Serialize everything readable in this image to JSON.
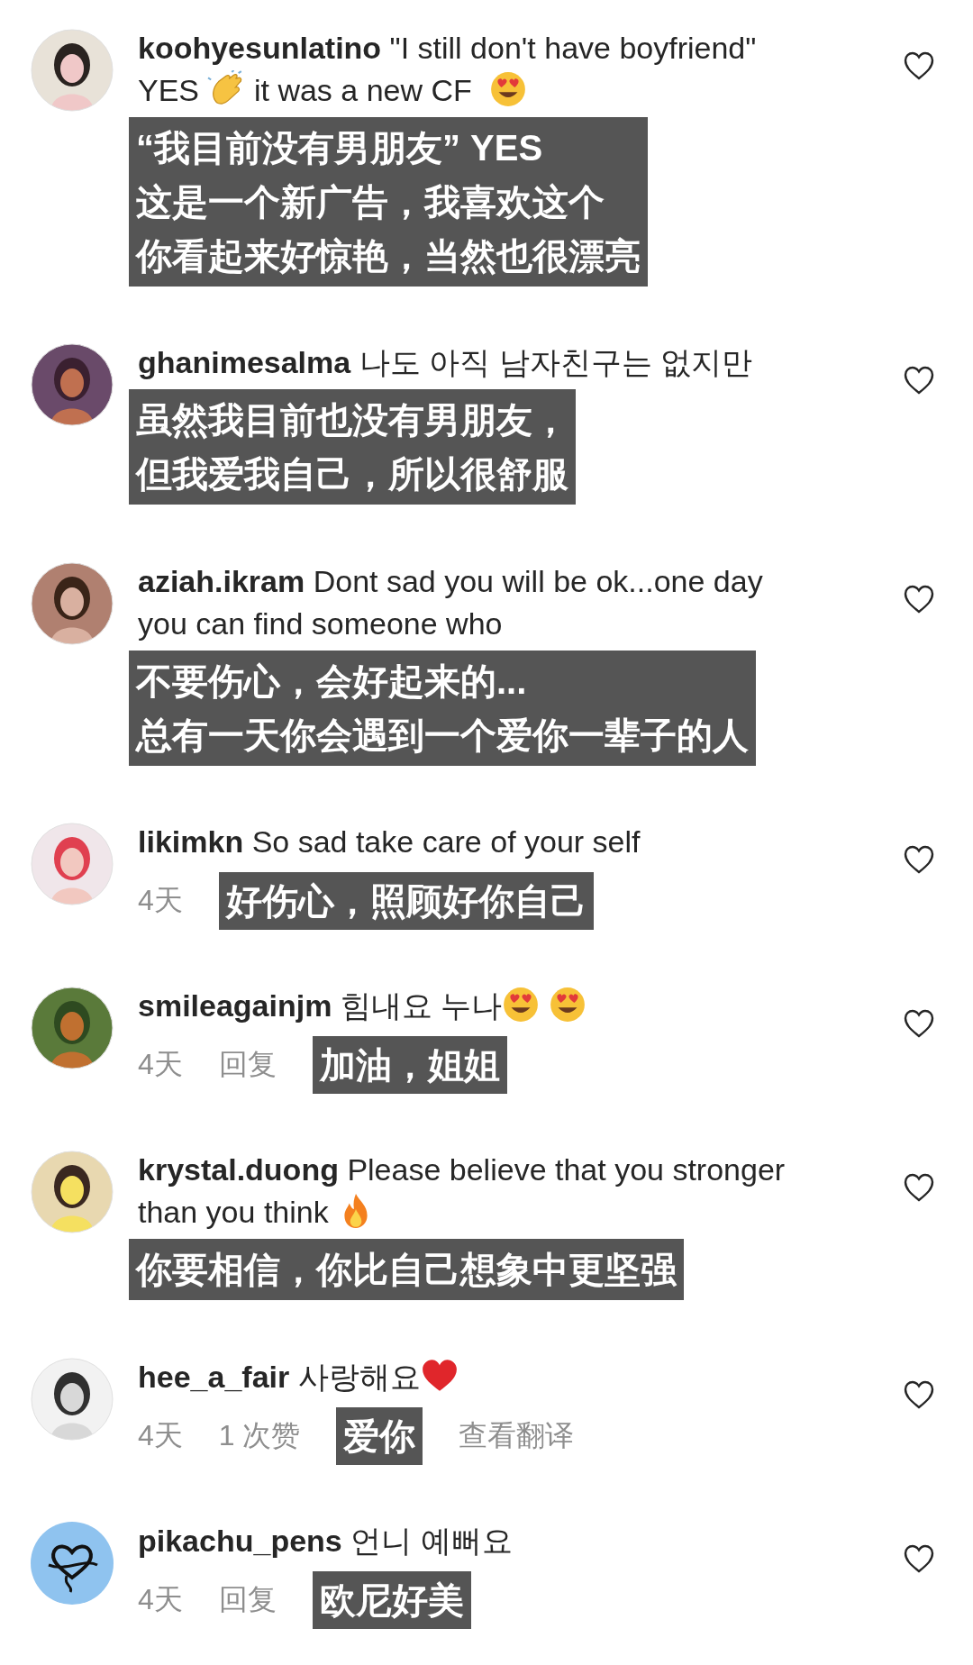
{
  "comments": [
    {
      "avatar": {
        "kind": "picture"
      },
      "username": "koohyesunlatino",
      "parts": [
        {
          "kind": "text",
          "text": "\"I still don't have boyfriend\"  YES "
        },
        {
          "kind": "clap"
        },
        {
          "kind": "text",
          "text": " it was a new CF "
        },
        {
          "kind": "heart-eyes"
        }
      ],
      "caption": [
        "“我目前没有男朋友” YES",
        "这是一个新广告，我喜欢这个",
        "你看起来好惊艳，当然也很漂亮"
      ],
      "liked": false
    },
    {
      "avatar": {
        "kind": "picture"
      },
      "username": "ghanimesalma",
      "parts": [
        {
          "kind": "text",
          "text": "나도 아직 남자친구는 없지만"
        }
      ],
      "caption": [
        "虽然我目前也没有男朋友，",
        "但我爱我自己，所以很舒服"
      ],
      "liked": false
    },
    {
      "avatar": {
        "kind": "picture"
      },
      "username": "aziah.ikram",
      "parts": [
        {
          "kind": "text",
          "text": "Dont sad you will be ok...one day you can find someone who"
        }
      ],
      "caption": [
        "不要伤心，会好起来的...",
        "总有一天你会遇到一个爱你一辈子的人"
      ],
      "liked": false
    },
    {
      "avatar": {
        "kind": "picture"
      },
      "username": "likimkn",
      "parts": [
        {
          "kind": "text",
          "text": "So sad take care of your self"
        }
      ],
      "meta": [
        {
          "kind": "meta",
          "text": "4天"
        },
        {
          "kind": "caption",
          "text": "好伤心，照顾好你自己"
        }
      ],
      "liked": false
    },
    {
      "avatar": {
        "kind": "picture"
      },
      "username": "smileagainjm",
      "parts": [
        {
          "kind": "text",
          "text": "힘내요 누나"
        },
        {
          "kind": "heart-eyes"
        },
        {
          "kind": "heart-eyes"
        }
      ],
      "meta": [
        {
          "kind": "meta",
          "text": "4天"
        },
        {
          "kind": "meta",
          "text": "回复"
        },
        {
          "kind": "caption",
          "text": "加油，姐姐"
        }
      ],
      "liked": false
    },
    {
      "avatar": {
        "kind": "picture"
      },
      "username": "krystal.duong",
      "parts": [
        {
          "kind": "text",
          "text": "Please believe that you stronger than you think "
        },
        {
          "kind": "fire"
        }
      ],
      "caption": [
        "你要相信，你比自己想象中更坚强"
      ],
      "liked": false
    },
    {
      "avatar": {
        "kind": "picture"
      },
      "username": "hee_a_fair",
      "parts": [
        {
          "kind": "text",
          "text": "사랑해요"
        },
        {
          "kind": "heart"
        }
      ],
      "meta": [
        {
          "kind": "meta",
          "text": "4天"
        },
        {
          "kind": "meta",
          "text": "1 次赞"
        },
        {
          "kind": "caption",
          "text": "爱你"
        },
        {
          "kind": "meta",
          "text": "查看翻译"
        }
      ],
      "liked": false
    },
    {
      "avatar": {
        "kind": "logo"
      },
      "username": "pikachu_pens",
      "parts": [
        {
          "kind": "text",
          "text": "언니 예뻐요"
        }
      ],
      "meta": [
        {
          "kind": "meta",
          "text": "4天"
        },
        {
          "kind": "meta",
          "text": "回复"
        },
        {
          "kind": "caption",
          "text": "欧尼好美"
        }
      ],
      "liked": false
    }
  ]
}
